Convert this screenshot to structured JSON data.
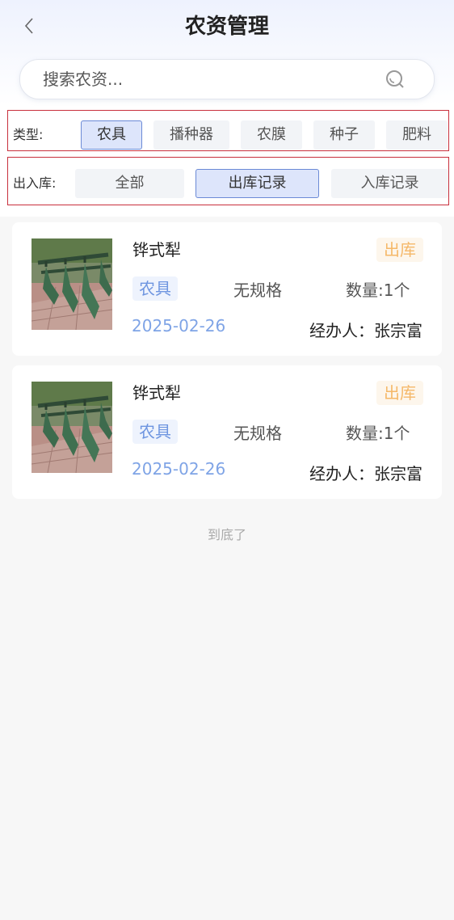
{
  "header": {
    "title": "农资管理",
    "back_icon": "chevron-left-icon"
  },
  "search": {
    "placeholder": "搜索农资...",
    "value": "",
    "icon": "search-icon"
  },
  "type_filter": {
    "label": "类型:",
    "options": [
      "农具",
      "播种器",
      "农膜",
      "种子",
      "肥料"
    ],
    "selected": "农具"
  },
  "inout_filter": {
    "label": "出入库:",
    "options": [
      "全部",
      "出库记录",
      "入库记录"
    ],
    "selected": "出库记录"
  },
  "records": [
    {
      "name": "铧式犁",
      "status": "出库",
      "category": "农具",
      "spec": "无规格",
      "quantity": "数量:1个",
      "date": "2025-02-26",
      "handler": "经办人：张宗富"
    },
    {
      "name": "铧式犁",
      "status": "出库",
      "category": "农具",
      "spec": "无规格",
      "quantity": "数量:1个",
      "date": "2025-02-26",
      "handler": "经办人：张宗富"
    }
  ],
  "footer": {
    "end_text": "到底了"
  },
  "colors": {
    "accent": "#6b8ad6",
    "status_text": "#f5b869",
    "date_text": "#7fa4e6",
    "filter_border": "#c8303d"
  }
}
